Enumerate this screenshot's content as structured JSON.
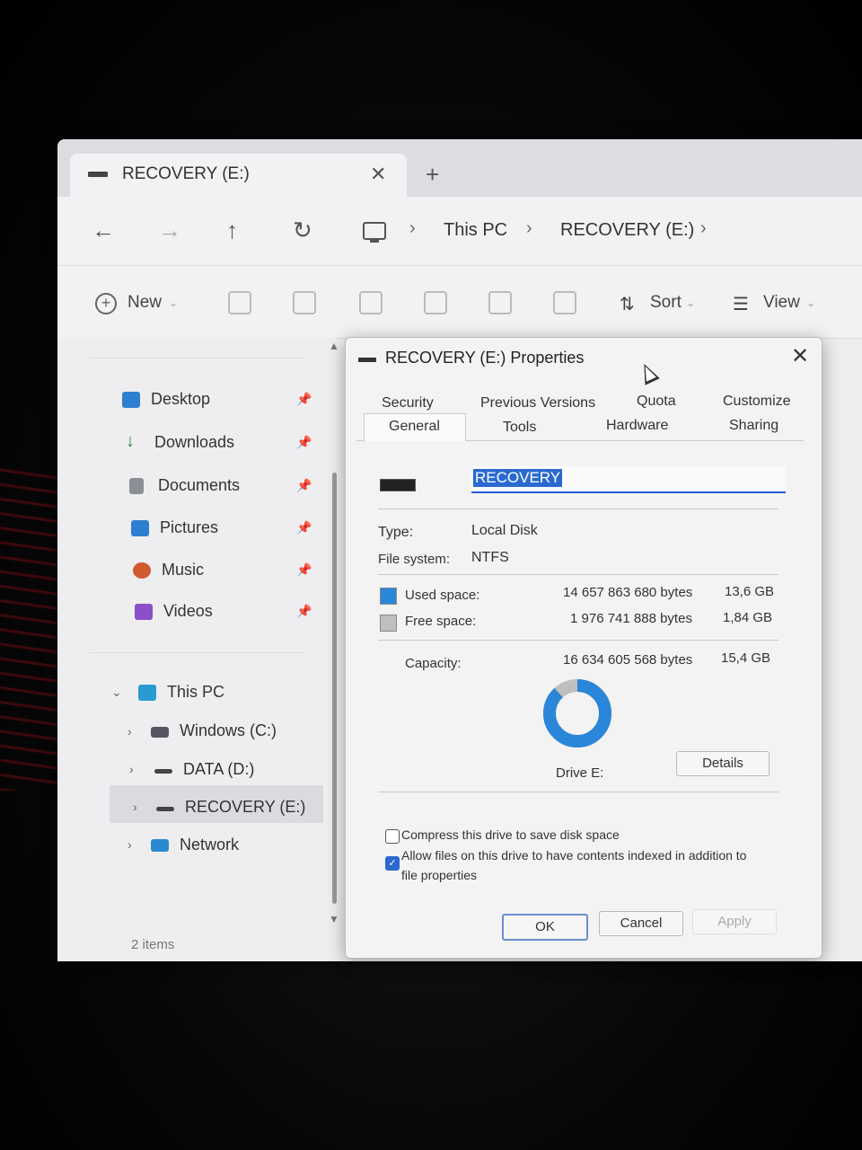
{
  "explorer": {
    "tab_title": "RECOVERY (E:)",
    "tab_close": "✕",
    "new_tab": "+",
    "nav": {
      "back": "←",
      "forward": "→",
      "up": "↑",
      "refresh": "↻"
    },
    "breadcrumb": [
      "This PC",
      "RECOVERY (E:)"
    ],
    "breadcrumb_sep": "›",
    "toolbar": {
      "new_label": "New",
      "sort_label": "Sort",
      "view_label": "View",
      "dropdown": "⌄"
    },
    "sidebar": {
      "quick_access": [
        {
          "label": "Desktop",
          "color": "#2f7fd0"
        },
        {
          "label": "Downloads",
          "color": "#2f8a4a"
        },
        {
          "label": "Documents",
          "color": "#8a8f96"
        },
        {
          "label": "Pictures",
          "color": "#2f7fd0"
        },
        {
          "label": "Music",
          "color": "#d05a2f"
        },
        {
          "label": "Videos",
          "color": "#8a4fc8"
        }
      ],
      "this_pc": "This PC",
      "drives": [
        "Windows (C:)",
        "DATA (D:)",
        "RECOVERY (E:)"
      ],
      "network": "Network"
    },
    "status": "2 items"
  },
  "dialog": {
    "title": "RECOVERY (E:) Properties",
    "close": "✕",
    "tabs_row1": [
      "Security",
      "Previous Versions",
      "Quota",
      "Customize"
    ],
    "tabs_row2": [
      "General",
      "Tools",
      "Hardware",
      "Sharing"
    ],
    "active_tab": "General",
    "volume_name": "RECOVERY",
    "type_label": "Type:",
    "type_value": "Local Disk",
    "fs_label": "File system:",
    "fs_value": "NTFS",
    "used_label": "Used space:",
    "used_bytes": "14 657 863 680 bytes",
    "used_gb": "13,6 GB",
    "free_label": "Free space:",
    "free_bytes": "1 976 741 888 bytes",
    "free_gb": "1,84 GB",
    "capacity_label": "Capacity:",
    "capacity_bytes": "16 634 605 568 bytes",
    "capacity_gb": "15,4 GB",
    "used_fraction": 0.881,
    "used_color": "#2a86d8",
    "free_color": "#bfbfbf",
    "drive_label": "Drive E:",
    "details_btn": "Details",
    "compress_label": "Compress this drive to save disk space",
    "compress_checked": false,
    "index_label_line1": "Allow files on this drive to have contents indexed in addition to",
    "index_label_line2": "file properties",
    "index_checked": true,
    "ok_btn": "OK",
    "cancel_btn": "Cancel",
    "apply_btn": "Apply"
  }
}
